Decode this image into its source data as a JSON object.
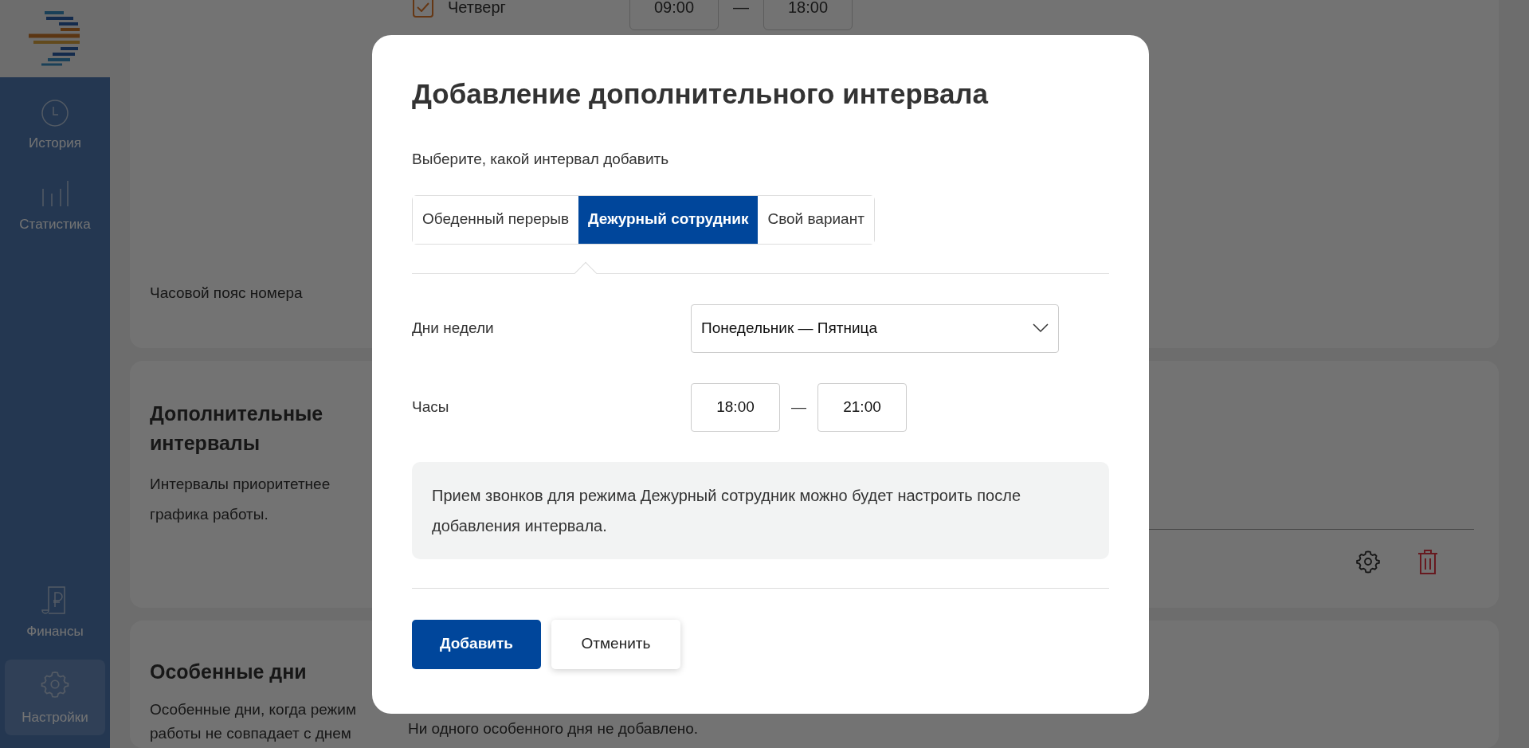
{
  "sidebar": {
    "items": [
      {
        "label": "История",
        "selected": false
      },
      {
        "label": "Статистика",
        "selected": false
      },
      {
        "label": "Финансы",
        "selected": false
      },
      {
        "label": "Настройки",
        "selected": true
      }
    ]
  },
  "page": {
    "schedule_row": {
      "day": "Четверг",
      "checked": true,
      "from": "09:00",
      "separator": "—",
      "to": "18:00"
    },
    "timezone_label": "Часовой пояс номера",
    "extra_intervals": {
      "title": "Дополнительные интервалы",
      "description": "Интервалы приоритетнее графика работы."
    },
    "special_days": {
      "title": "Особенные дни",
      "description": "Особенные дни, когда режим работы не совпадает с днем",
      "empty_text": "Ни одного особенного дня не добавлено."
    }
  },
  "dialog": {
    "title": "Добавление дополнительного интервала",
    "subtitle": "Выберите, какой интервал добавить",
    "tabs": [
      {
        "label": "Обеденный перерыв",
        "selected": false
      },
      {
        "label": "Дежурный сотрудник",
        "selected": true
      },
      {
        "label": "Свой вариант",
        "selected": false
      }
    ],
    "fields": [
      {
        "kind": "select",
        "label": "Дни недели",
        "value": "Понедельник — Пятница"
      },
      {
        "kind": "time_range",
        "label": "Часы",
        "from": "18:00",
        "separator": "—",
        "to": "21:00"
      }
    ],
    "note": "Прием звонков для режима Дежурный сотрудник можно будет настроить после добавления интервала.",
    "buttons": [
      {
        "kind": "primary",
        "label": "Добавить"
      },
      {
        "kind": "secondary",
        "label": "Отменить"
      }
    ]
  }
}
